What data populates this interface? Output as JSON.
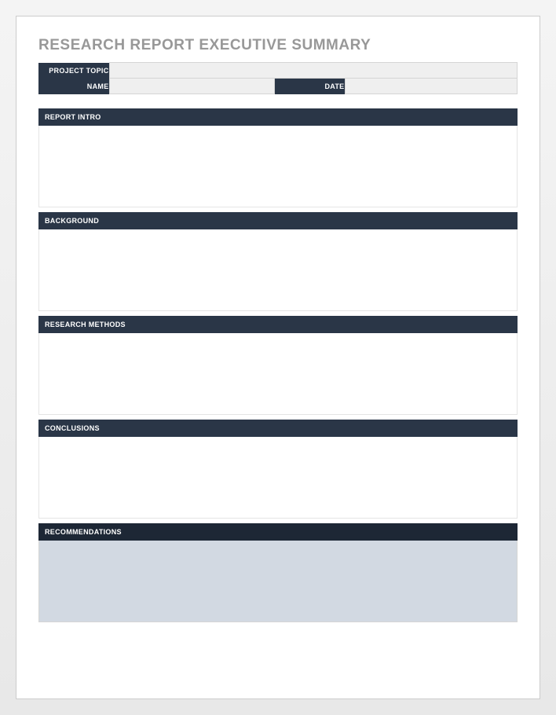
{
  "title": "RESEARCH REPORT EXECUTIVE SUMMARY",
  "header": {
    "projectTopicLabel": "PROJECT TOPIC",
    "projectTopicValue": "",
    "nameLabel": "NAME",
    "nameValue": "",
    "dateLabel": "DATE",
    "dateValue": ""
  },
  "sections": [
    {
      "label": "REPORT INTRO",
      "value": "",
      "shaded": false
    },
    {
      "label": "BACKGROUND",
      "value": "",
      "shaded": false
    },
    {
      "label": "RESEARCH METHODS",
      "value": "",
      "shaded": false
    },
    {
      "label": "CONCLUSIONS",
      "value": "",
      "shaded": false
    },
    {
      "label": "RECOMMENDATIONS",
      "value": "",
      "shaded": true
    }
  ]
}
